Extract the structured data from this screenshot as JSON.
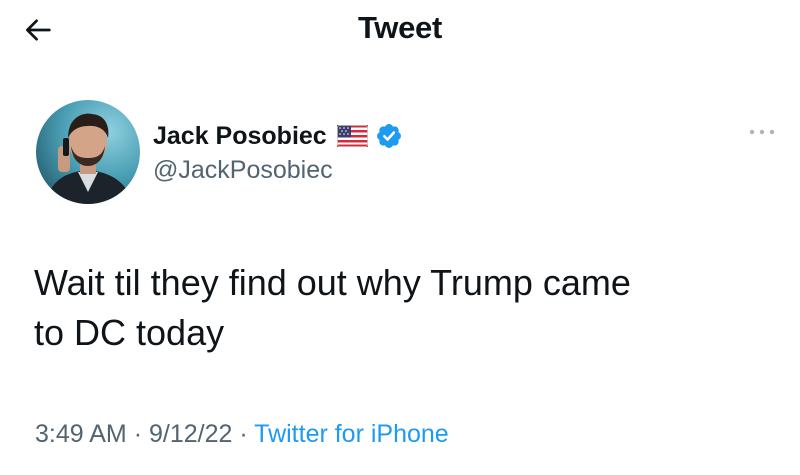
{
  "header": {
    "title": "Tweet"
  },
  "tweet": {
    "author": {
      "display_name": "Jack Posobiec",
      "handle": "@JackPosobiec",
      "flag_icon": "us-flag-icon",
      "verified_icon": "verified-badge-icon",
      "verified_color": "#1d9bf0"
    },
    "text_line_1": "Wait til they find out why Trump came",
    "text_line_2": "to DC today",
    "time": "3:49 AM",
    "separator": "·",
    "date": "9/12/22",
    "source": "Twitter for iPhone"
  },
  "colors": {
    "text_primary": "#0f1419",
    "text_secondary": "#536471",
    "accent": "#1d9bf0",
    "background": "#ffffff"
  }
}
